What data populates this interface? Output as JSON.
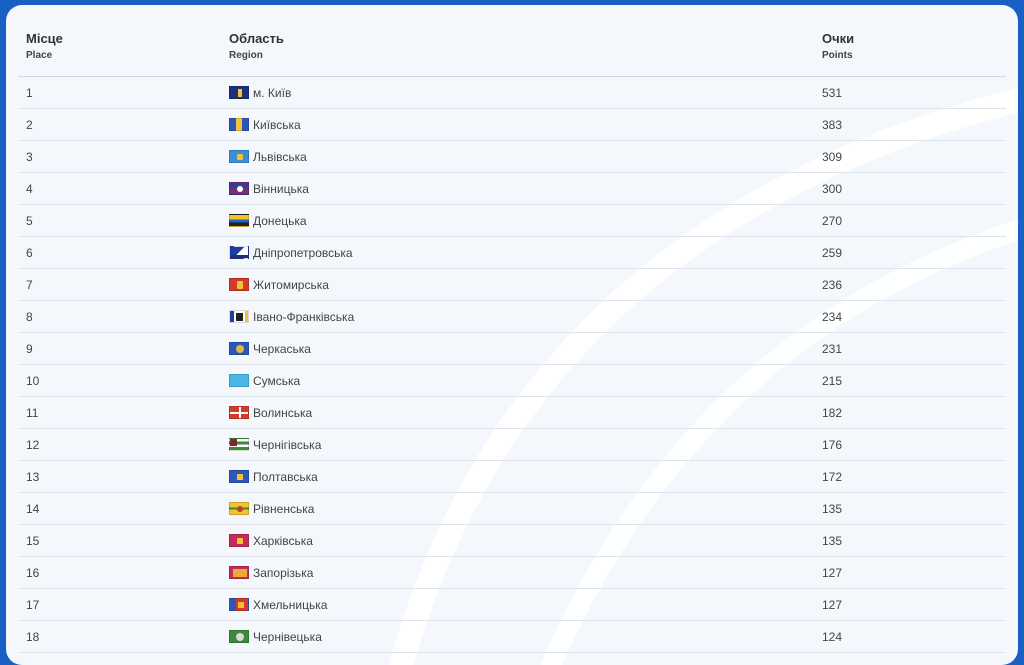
{
  "header": {
    "place_uk": "Місце",
    "place_en": "Place",
    "region_uk": "Область",
    "region_en": "Region",
    "points_uk": "Очки",
    "points_en": "Points"
  },
  "rows": [
    {
      "place": "1",
      "region": "м. Київ",
      "points": "531",
      "flag": "kyiv-city-flag-icon"
    },
    {
      "place": "2",
      "region": "Київська",
      "points": "383",
      "flag": "kyiv-oblast-flag-icon"
    },
    {
      "place": "3",
      "region": "Львівська",
      "points": "309",
      "flag": "lviv-flag-icon"
    },
    {
      "place": "4",
      "region": "Вінницька",
      "points": "300",
      "flag": "vinnytsia-flag-icon"
    },
    {
      "place": "5",
      "region": "Донецька",
      "points": "270",
      "flag": "donetsk-flag-icon"
    },
    {
      "place": "6",
      "region": "Дніпропетровська",
      "points": "259",
      "flag": "dnipro-flag-icon"
    },
    {
      "place": "7",
      "region": "Житомирська",
      "points": "236",
      "flag": "zhytomyr-flag-icon"
    },
    {
      "place": "8",
      "region": "Івано-Франківська",
      "points": "234",
      "flag": "ivano-frankivsk-flag-icon"
    },
    {
      "place": "9",
      "region": "Черкаська",
      "points": "231",
      "flag": "cherkasy-flag-icon"
    },
    {
      "place": "10",
      "region": "Сумська",
      "points": "215",
      "flag": "sumy-flag-icon"
    },
    {
      "place": "11",
      "region": "Волинська",
      "points": "182",
      "flag": "volyn-flag-icon"
    },
    {
      "place": "12",
      "region": "Чернігівська",
      "points": "176",
      "flag": "chernihiv-flag-icon"
    },
    {
      "place": "13",
      "region": "Полтавська",
      "points": "172",
      "flag": "poltava-flag-icon"
    },
    {
      "place": "14",
      "region": "Рівненська",
      "points": "135",
      "flag": "rivne-flag-icon"
    },
    {
      "place": "15",
      "region": "Харківська",
      "points": "135",
      "flag": "kharkiv-flag-icon"
    },
    {
      "place": "16",
      "region": "Запорізька",
      "points": "127",
      "flag": "zaporizhzhia-flag-icon"
    },
    {
      "place": "17",
      "region": "Хмельницька",
      "points": "127",
      "flag": "khmelnytskyi-flag-icon"
    },
    {
      "place": "18",
      "region": "Чернівецька",
      "points": "124",
      "flag": "chernivtsi-flag-icon"
    }
  ],
  "colors": {
    "frame": "#1a5fc4",
    "card": "#f4f7fb",
    "divider": "#dde3ea"
  }
}
